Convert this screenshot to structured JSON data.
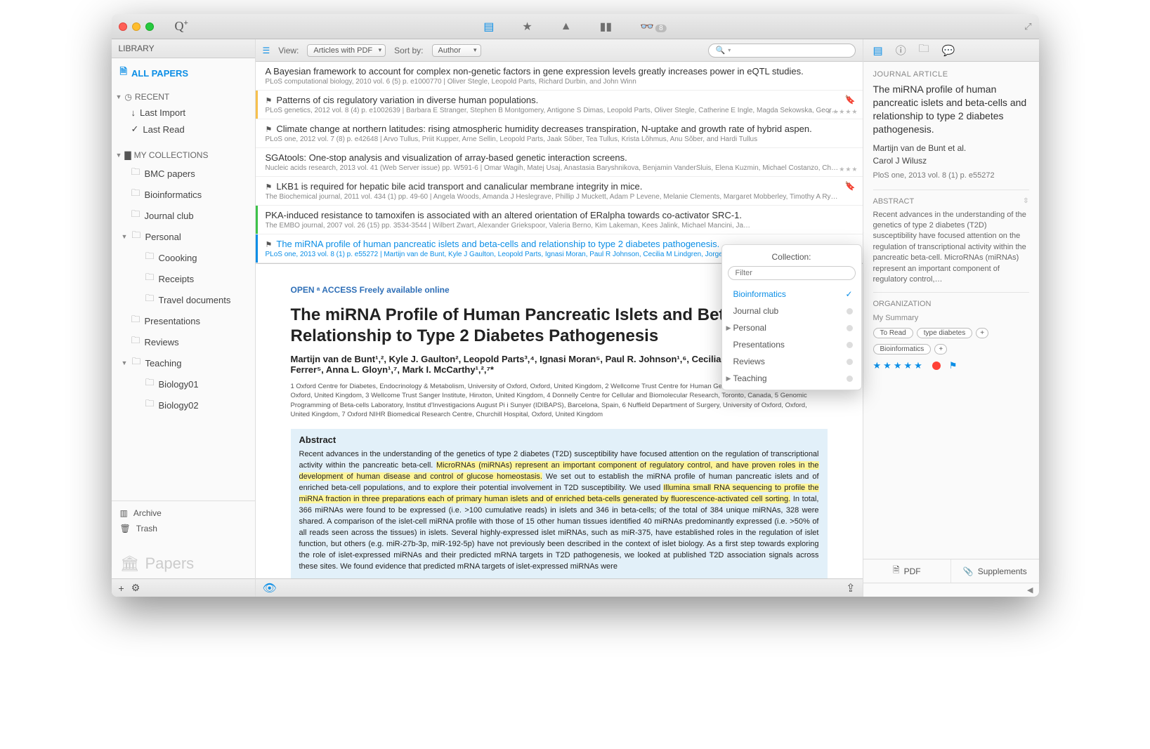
{
  "sidebar": {
    "head": "LIBRARY",
    "all": "ALL PAPERS",
    "recent": "RECENT",
    "recent_items": [
      "Last Import",
      "Last Read"
    ],
    "mycoll": "MY COLLECTIONS",
    "collections": {
      "bmc": "BMC papers",
      "bio": "Bioinformatics",
      "jc": "Journal club",
      "pers": "Personal",
      "cook": "Coooking",
      "rec": "Receipts",
      "trav": "Travel documents",
      "pres": "Presentations",
      "rev": "Reviews",
      "teach": "Teaching",
      "b01": "Biology01",
      "b02": "Biology02"
    },
    "archive": "Archive",
    "trash": "Trash",
    "brand": "Papers"
  },
  "toolbar": {
    "view_lbl": "View:",
    "view_val": "Articles with PDF",
    "sort_lbl": "Sort by:",
    "sort_val": "Author",
    "search_placeholder": ""
  },
  "rows": [
    {
      "title": "A Bayesian framework to account for complex non-genetic factors in gene expression levels greatly increases power in eQTL studies.",
      "sub": "PLoS computational biology, 2010 vol. 6 (5) p. e1000770 | Oliver Stegle, Leopold Parts, Richard Durbin, and John Winn",
      "bar": "",
      "flag": false,
      "bookmark": false,
      "stars": ""
    },
    {
      "title": "Patterns of cis regulatory variation in diverse human populations.",
      "sub": "PLoS genetics, 2012 vol. 8 (4) p. e1002639 | Barbara E Stranger, Stephen B Montgomery, Antigone S Dimas, Leopold Parts, Oliver Stegle, Catherine E Ingle, Magda Sekowska, George…",
      "bar": "#f6c04d",
      "flag": true,
      "bookmark": true,
      "stars": "★★★★★"
    },
    {
      "title": "Climate change at northern latitudes: rising atmospheric humidity decreases transpiration, N-uptake and growth rate of hybrid aspen.",
      "sub": "PLoS one, 2012 vol. 7 (8) p. e42648 | Arvo Tullus, Priit Kupper, Arne Sellin, Leopold Parts, Jaak Sõber, Tea Tullus, Krista Lõhmus, Anu Sõber, and Hardi Tullus",
      "bar": "",
      "flag": true,
      "bookmark": false,
      "stars": ""
    },
    {
      "title": "SGAtools: One-stop analysis and visualization of array-based genetic interaction screens.",
      "sub": "Nucleic acids research, 2013 vol. 41 (Web Server issue) pp. W591-6 | Omar Wagih, Matej Usaj, Anastasia Baryshnikova, Benjamin VanderSluis, Elena Kuzmin, Michael Costanzo, Chad L…",
      "bar": "",
      "flag": false,
      "bookmark": false,
      "stars": "★★★"
    },
    {
      "title": "LKB1 is required for hepatic bile acid transport and canalicular membrane integrity in mice.",
      "sub": "The Biochemical journal, 2011 vol. 434 (1) pp. 49-60 | Angela Woods, Amanda J Heslegrave, Phillip J Muckett, Adam P Levene, Melanie Clements, Margaret Mobberley, Timothy A Ry…",
      "bar": "",
      "flag": true,
      "bookmark": true,
      "stars": ""
    },
    {
      "title": "PKA-induced resistance to tamoxifen is associated with an altered orientation of ERalpha towards co-activator SRC-1.",
      "sub": "The EMBO journal, 2007 vol. 26 (15) pp. 3534-3544 | Wilbert Zwart, Alexander Griekspoor, Valeria Berno, Kim Lakeman, Kees Jalink, Michael Mancini, Ja…",
      "bar": "#3cc24a",
      "flag": false,
      "bookmark": false,
      "stars": ""
    },
    {
      "title": "The miRNA profile of human pancreatic islets and beta-cells and relationship to type 2 diabetes pathogenesis.",
      "sub": "PLoS one, 2013 vol. 8 (1) p. e55272 | Martijn van de Bunt, Kyle J Gaulton, Leopold Parts, Ignasi Moran, Paul R Johnson, Cecilia M Lindgren, Jorge Ferrer, An…",
      "bar": "#0b8ee6",
      "flag": true,
      "bookmark": false,
      "stars": ""
    }
  ],
  "preview": {
    "oa": "OPEN ᵃ ACCESS  Freely available online",
    "title": "The miRNA Profile of Human Pancreatic Islets and Beta-Cells and Relationship to Type 2 Diabetes Pathogenesis",
    "authors": "Martijn van de Bunt¹,², Kyle J. Gaulton², Leopold Parts³,⁴, Ignasi Moran⁵, Paul R. Johnson¹,⁶, Cecilia M. Lindgren², Jorge Ferrer⁵, Anna L. Gloyn¹,⁷, Mark I. McCarthy¹,²,⁷*",
    "affil": "1 Oxford Centre for Diabetes, Endocrinology & Metabolism, University of Oxford, Oxford, United Kingdom, 2 Wellcome Trust Centre for Human Genetics, University of Oxford, Oxford, United Kingdom, 3 Wellcome Trust Sanger Institute, Hinxton, United Kingdom, 4 Donnelly Centre for Cellular and Biomolecular Research, Toronto, Canada, 5 Genomic Programming of Beta-cells Laboratory, Institut d'Investigacions August Pi i Sunyer (IDIBAPS), Barcelona, Spain, 6 Nuffield Department of Surgery, University of Oxford, Oxford, United Kingdom, 7 Oxford NIHR Biomedical Research Centre, Churchill Hospital, Oxford, United Kingdom",
    "abs_head": "Abstract",
    "abs_pre": "Recent advances in the understanding of the genetics of type 2 diabetes (T2D) susceptibility have focused attention on the regulation of transcriptional activity within the pancreatic beta-cell. ",
    "abs_hl1": "MicroRNAs (miRNAs) represent an important component of regulatory control, and have proven roles in the development of human disease and control of glucose homeostasis.",
    "abs_mid": " We set out to establish the miRNA profile of human pancreatic islets and of enriched beta-cell populations, and to explore their potential involvement in T2D susceptibility. We used ",
    "abs_hl2": "Illumina small RNA sequencing to profile the miRNA fraction in three preparations each of primary human islets and of enriched beta-cells generated by fluorescence-activated cell sorting.",
    "abs_post": " In total, 366 miRNAs were found to be expressed (i.e. >100 cumulative reads) in islets and 346 in beta-cells; of the total of 384 unique miRNAs, 328 were shared. A comparison of the islet-cell miRNA profile with those of 15 other human tissues identified 40 miRNAs predominantly expressed (i.e. >50% of all reads seen across the tissues) in islets. Several highly-expressed islet miRNAs, such as miR-375, have established roles in the regulation of islet function, but others (e.g. miR-27b-3p, miR-192-5p) have not previously been described in the context of islet biology. As a first step towards exploring the role of islet-expressed miRNAs and their predicted mRNA targets in T2D pathogenesis, we looked at published T2D association signals across these sites. We found evidence that predicted mRNA targets of islet-expressed miRNAs were"
  },
  "rpanel": {
    "type": "JOURNAL ARTICLE",
    "title": "The miRNA profile of human pancreatic islets and beta-cells and relationship to type 2 diabetes pathogenesis.",
    "auth1": "Martijn van de Bunt et al.",
    "auth2": "Carol J Wilusz",
    "cite": "PloS one, 2013 vol. 8 (1) p. e55272",
    "abs_lbl": "ABSTRACT",
    "abs": "Recent advances in the understanding of the genetics of type 2 diabetes (T2D) susceptibility have focused attention on the regulation of transcriptional activity within the pancreatic beta-cell. MicroRNAs (miRNAs) represent an important component of regulatory control,…",
    "org_lbl": "ORGANIZATION",
    "summary": "My Summary",
    "tags1": [
      "To Read",
      "type diabetes"
    ],
    "tags2": [
      "Bioinformatics"
    ],
    "pdf": "PDF",
    "supp": "Supplements"
  },
  "popover": {
    "title": "Collection:",
    "filter_ph": "Filter",
    "items": [
      {
        "label": "Bioinformatics",
        "sel": true,
        "exp": false
      },
      {
        "label": "Journal club",
        "sel": false,
        "exp": false
      },
      {
        "label": "Personal",
        "sel": false,
        "exp": true
      },
      {
        "label": "Presentations",
        "sel": false,
        "exp": false
      },
      {
        "label": "Reviews",
        "sel": false,
        "exp": false
      },
      {
        "label": "Teaching",
        "sel": false,
        "exp": true
      }
    ]
  },
  "glasses_badge": "8"
}
